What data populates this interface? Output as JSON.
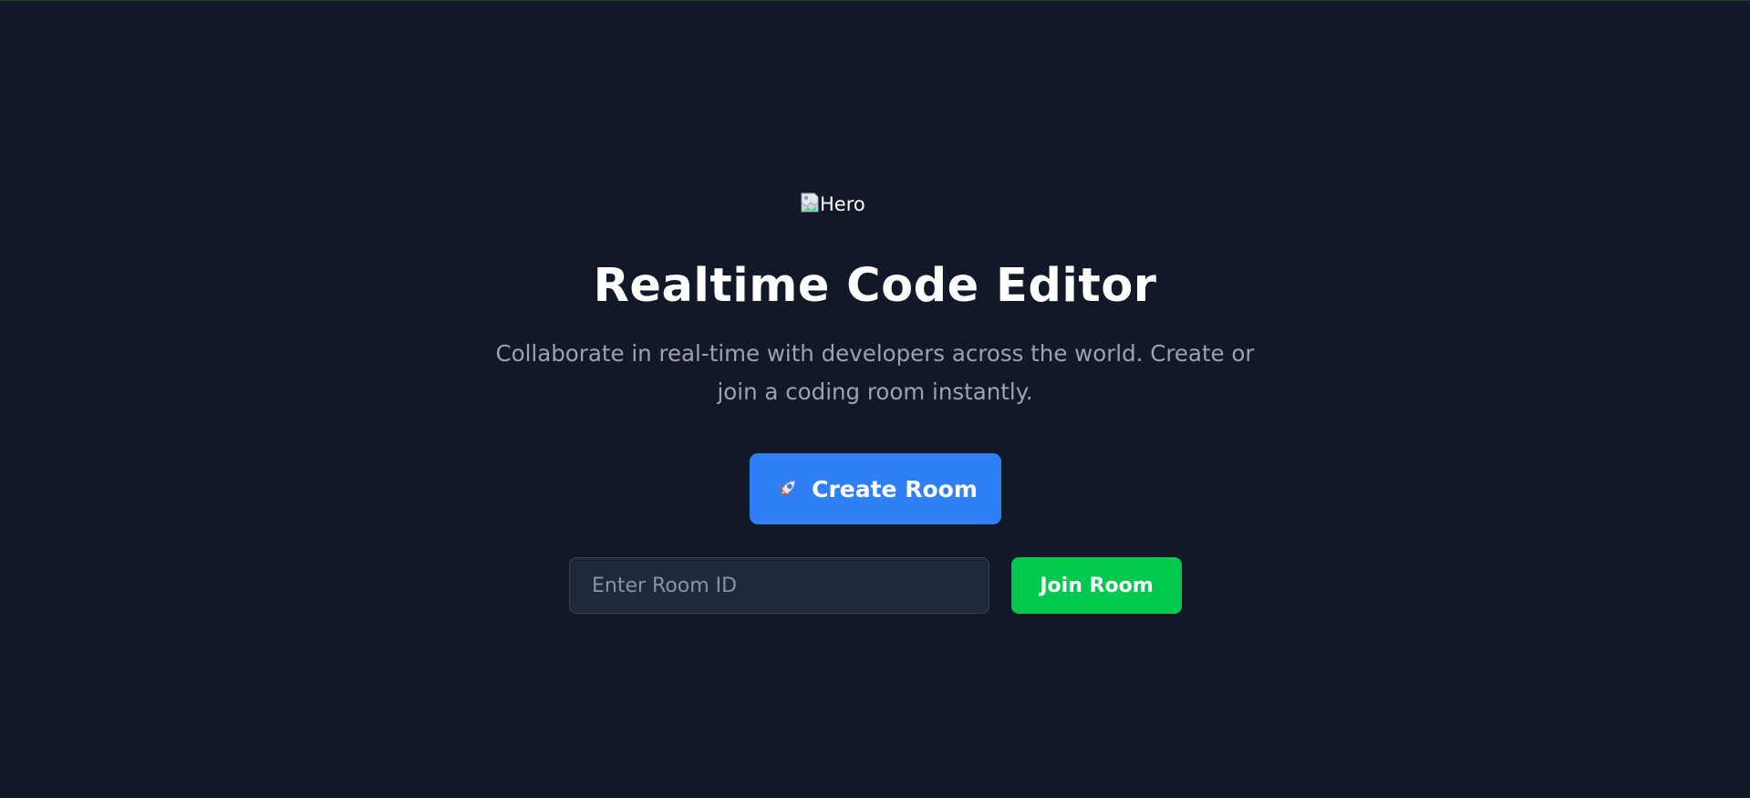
{
  "hero": {
    "image_alt": "Hero",
    "image_icon": "broken-image-icon"
  },
  "title": "Realtime Code Editor",
  "subtitle": "Collaborate in real-time with developers across the world. Create or join a coding room instantly.",
  "create_button": {
    "icon": "rocket-icon",
    "label": "Create Room"
  },
  "room_input": {
    "value": "",
    "placeholder": "Enter Room ID"
  },
  "join_button": {
    "label": "Join Room"
  },
  "colors": {
    "background": "#111827",
    "primary": "#2f7ff6",
    "success": "#00c950",
    "input_bg": "#1e293b",
    "muted_text": "#9ca3af"
  }
}
